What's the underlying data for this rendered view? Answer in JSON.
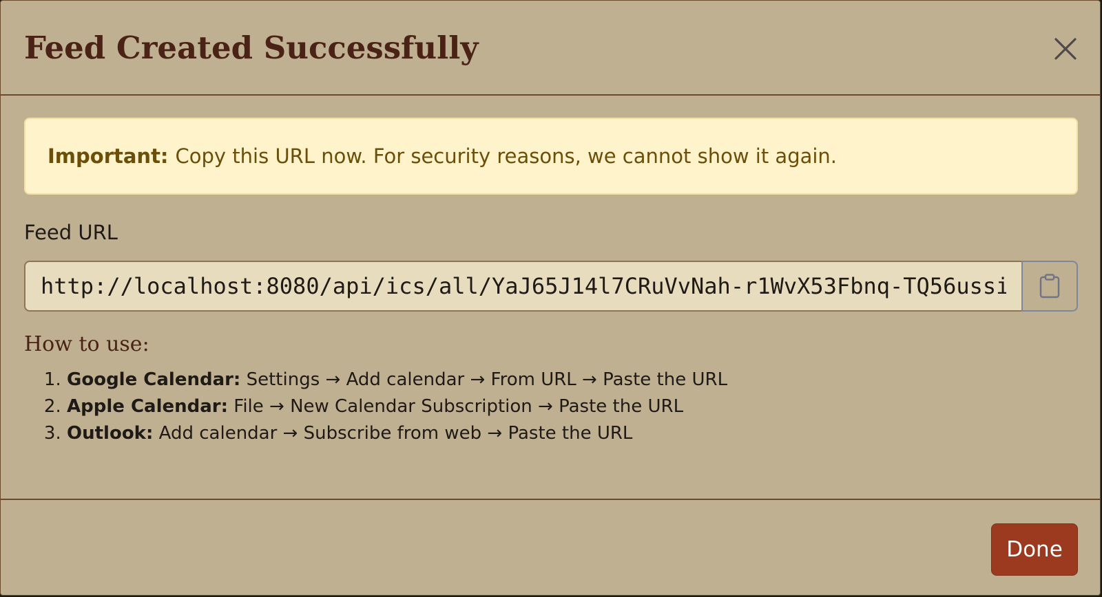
{
  "dialog": {
    "title": "Feed Created Successfully",
    "close_icon": "close-icon"
  },
  "alert": {
    "strong": "Important:",
    "message": "Copy this URL now. For security reasons, we cannot show it again.",
    "background": "#fff3cc",
    "text_color": "#6b4e08"
  },
  "feed_url": {
    "label": "Feed URL",
    "value": "http://localhost:8080/api/ics/all/YaJ65J14l7CRuVvNah-r1WvX53Fbnq-TQ56ussi",
    "copy_icon": "clipboard-icon"
  },
  "howto": {
    "title": "How to use:",
    "steps": [
      {
        "label": "Google Calendar:",
        "text": "Settings → Add calendar → From URL → Paste the URL"
      },
      {
        "label": "Apple Calendar:",
        "text": "File → New Calendar Subscription → Paste the URL"
      },
      {
        "label": "Outlook:",
        "text": "Add calendar → Subscribe from web → Paste the URL"
      }
    ]
  },
  "footer": {
    "done_label": "Done",
    "done_color": "#9c3a20"
  },
  "colors": {
    "modal_background": "#bfb091",
    "title_color": "#4a2316",
    "border": "#6b4a2c"
  }
}
